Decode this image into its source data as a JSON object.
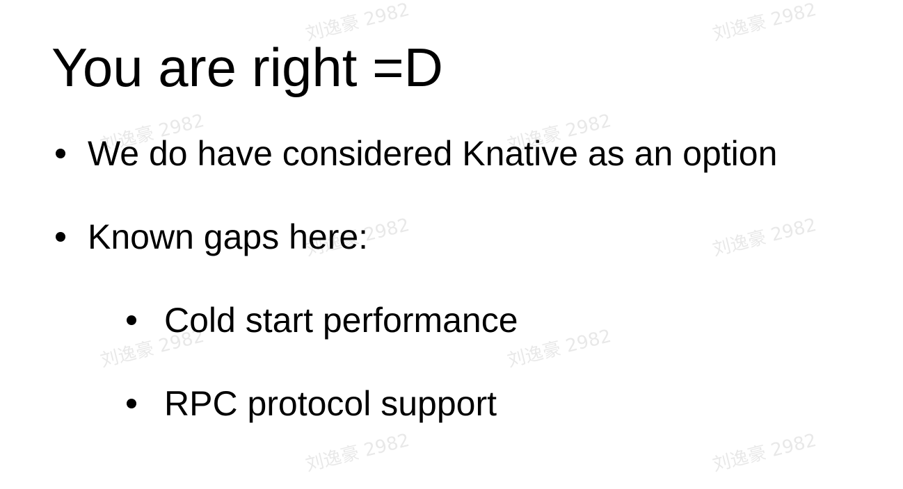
{
  "slide": {
    "title": "You are right =D",
    "bullets": [
      "We do have considered Knative as an option",
      "Known gaps here:"
    ],
    "sub_bullets": [
      "Cold start performance",
      "RPC protocol support"
    ],
    "watermark": "刘逸豪 2982"
  }
}
